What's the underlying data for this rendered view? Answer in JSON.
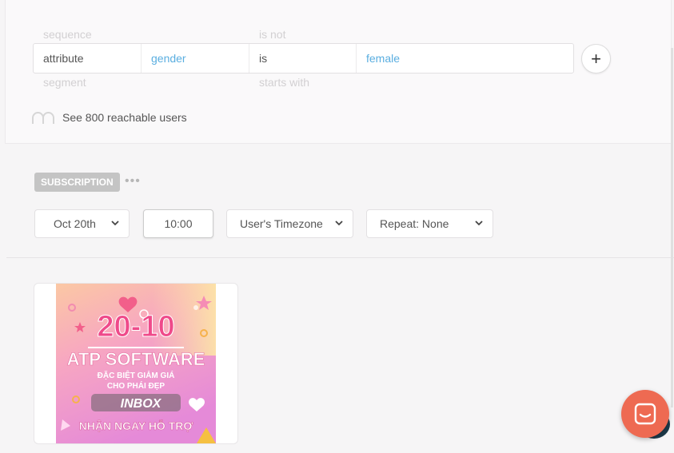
{
  "filter": {
    "ghost_above": {
      "col1": "sequence",
      "col3": "is not"
    },
    "row": {
      "type": "attribute",
      "field": "gender",
      "operator": "is",
      "value": "female"
    },
    "ghost_below": {
      "col1": "segment",
      "col3": "starts with"
    },
    "add_label": "+",
    "reach_text": "See 800 reachable users"
  },
  "campaign": {
    "badge": "SUBSCRIPTION",
    "more": "•••",
    "date": "Oct 20th",
    "time": "10:00",
    "timezone": "User's Timezone",
    "repeat": "Repeat: None"
  },
  "poster": {
    "date_text": "20-10",
    "brand": "ATP SOFTWARE",
    "line1": "ĐẶC BIỆT GIẢM GIÁ",
    "line2": "CHO PHÁI ĐẸP",
    "inbox": "INBOX",
    "footer": "NHẬN NGAY HỖ TRỢ"
  },
  "colors": {
    "link": "#5aaee0",
    "badge": "#c4c4c4",
    "chat": "#ee6a52"
  },
  "icons": {
    "add": "plus-icon",
    "reach": "users-icon",
    "select": "chevron-down-icon",
    "chat": "chat-icon"
  }
}
